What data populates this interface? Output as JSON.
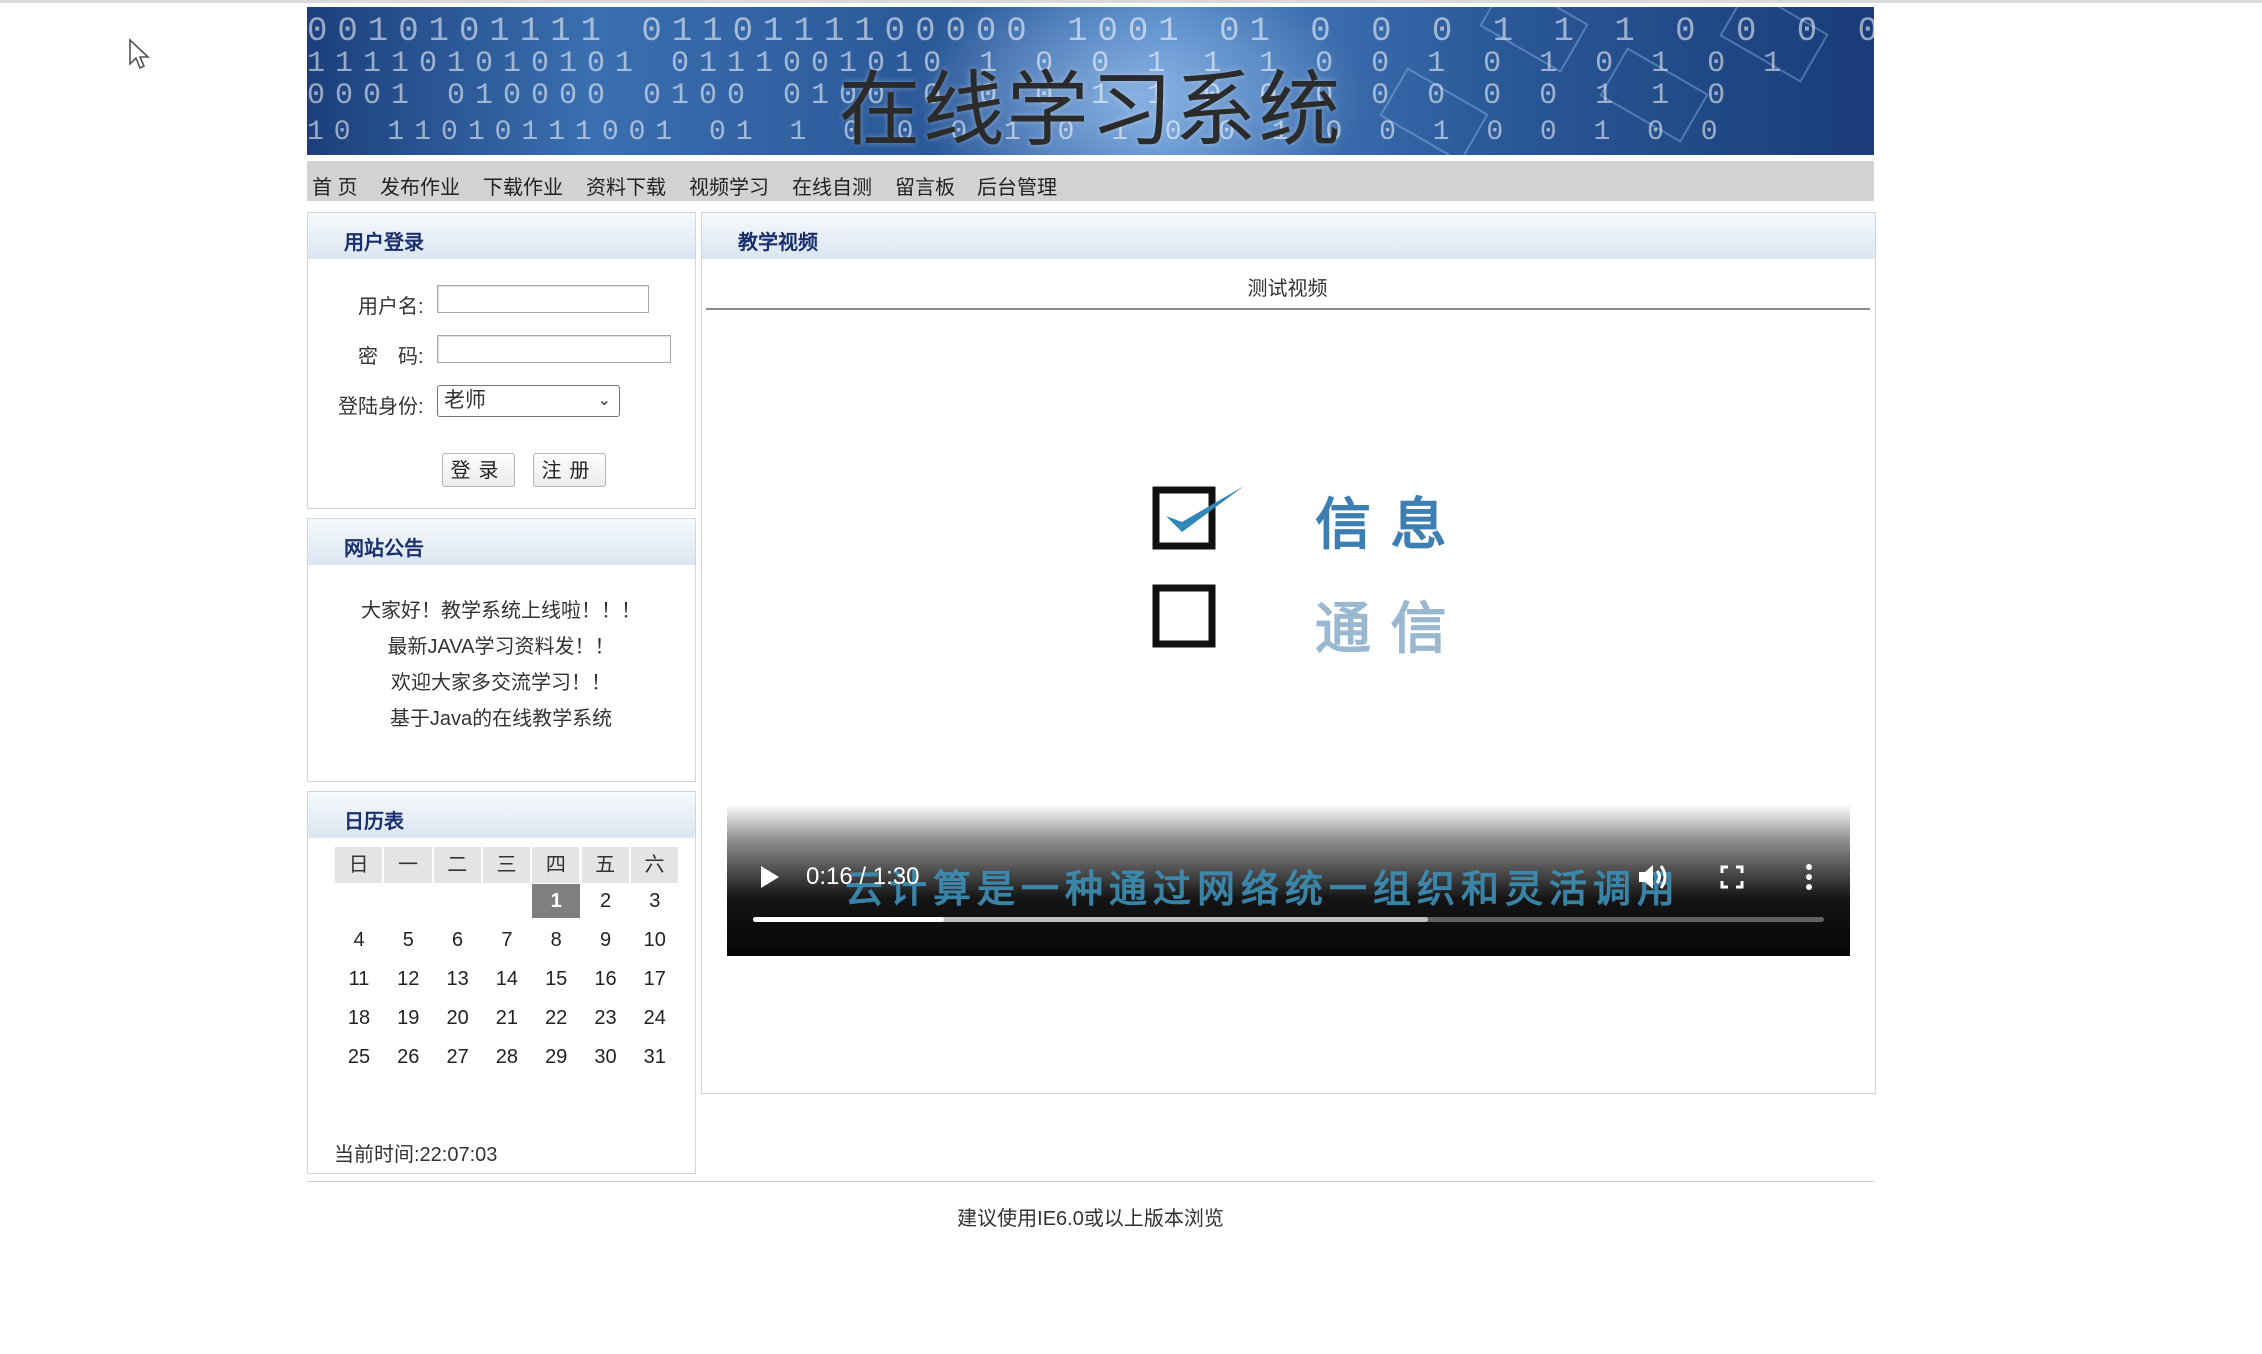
{
  "banner": {
    "title": "在线学习系统"
  },
  "nav": {
    "items": [
      {
        "label": "首 页"
      },
      {
        "label": "发布作业"
      },
      {
        "label": "下载作业"
      },
      {
        "label": "资料下载"
      },
      {
        "label": "视频学习"
      },
      {
        "label": "在线自测"
      },
      {
        "label": "留言板"
      },
      {
        "label": "后台管理"
      }
    ]
  },
  "login": {
    "title": "用户登录",
    "username_label": "用户名:",
    "username_value": "",
    "password_label": "密　码:",
    "password_value": "",
    "role_label": "登陆身份:",
    "role_selected": "老师",
    "login_button": "登录",
    "register_button": "注册"
  },
  "notice": {
    "title": "网站公告",
    "lines": [
      "大家好！教学系统上线啦！！！",
      "最新JAVA学习资料发！！",
      "欢迎大家多交流学习！！",
      "基于Java的在线教学系统"
    ]
  },
  "calendar": {
    "title": "日历表",
    "weekdays": [
      "日",
      "一",
      "二",
      "三",
      "四",
      "五",
      "六"
    ],
    "first_weekday_index": 4,
    "days_in_month": 31,
    "today": 1,
    "time_text": "当前时间:22:07:03"
  },
  "video_panel": {
    "title": "教学视频",
    "video_title": "测试视频",
    "frame_words": {
      "checked": "信 息",
      "unchecked": "通 信",
      "caption": "云计算是一种通过网络统一组织和灵活调用"
    },
    "time_display": "0:16 / 1:30",
    "progress_played": 0.178,
    "progress_buffered": 0.63,
    "icons": [
      "play-icon",
      "volume-icon",
      "fullscreen-icon",
      "more-options-icon"
    ]
  },
  "footer": {
    "text": "建议使用IE6.0或以上版本浏览"
  },
  "colors": {
    "panel_title": "#1a2f6e",
    "nav_bg": "#d2d2d2",
    "check_blue": "#2e88b8",
    "word_blue": "#3d7fb3"
  }
}
